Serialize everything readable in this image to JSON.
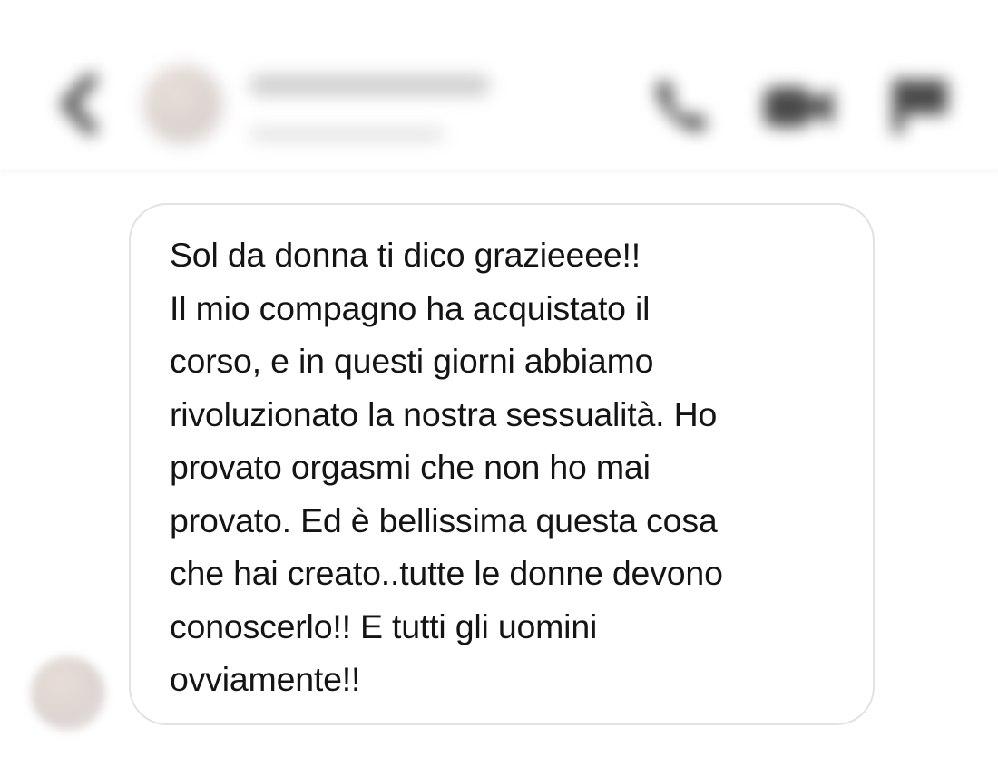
{
  "header": {
    "contact_name": "",
    "contact_status": "",
    "icons": {
      "back": "chevron-left-icon",
      "phone": "phone-icon",
      "video": "video-camera-icon",
      "flag": "flag-icon"
    }
  },
  "message": {
    "lines": [
      "Sol da donna ti dico grazieeee!!",
      "Il mio compagno ha acquistato il",
      "corso, e in questi giorni abbiamo",
      "rivoluzionato la nostra sessualità. Ho",
      "provato orgasmi che non ho mai",
      "provato. Ed è bellissima questa cosa",
      "che hai creato..tutte le donne devono",
      "conoscerlo!! E tutti gli uomini",
      "ovviamente!!"
    ]
  },
  "colors": {
    "text": "#141414",
    "bubble_border": "#e2e2e2",
    "icon_gray": "#4a4a4a",
    "background": "#ffffff"
  }
}
